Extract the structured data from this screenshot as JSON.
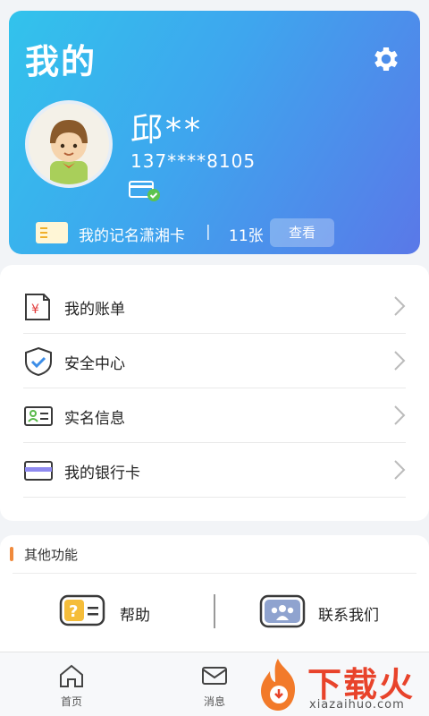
{
  "header": {
    "title": "我的",
    "user_name": "邱**",
    "phone": "137****8105",
    "cards_label": "我的记名潇湘卡",
    "separator": "|",
    "cards_count": "11张",
    "view_label": "查看",
    "icons": [
      "gear-icon",
      "avatar",
      "verified-card-icon",
      "cards-icon"
    ]
  },
  "menu": {
    "items": [
      {
        "label": "我的账单",
        "icon": "bill-icon"
      },
      {
        "label": "安全中心",
        "icon": "shield-icon"
      },
      {
        "label": "实名信息",
        "icon": "id-card-icon"
      },
      {
        "label": "我的银行卡",
        "icon": "bank-card-icon"
      }
    ]
  },
  "other": {
    "title": "其他功能",
    "help_label": "帮助",
    "contact_label": "联系我们"
  },
  "tabbar": {
    "items": [
      {
        "label": "首页",
        "icon": "home-icon"
      },
      {
        "label": "消息",
        "icon": "message-icon"
      }
    ]
  },
  "watermark": {
    "text": "下载火",
    "url": "xiazaihuo.com"
  },
  "colors": {
    "header_gradient_start": "#32c3ec",
    "header_gradient_end": "#5a78e8",
    "accent_orange": "#f08a3c",
    "watermark_red": "#e8432b"
  }
}
